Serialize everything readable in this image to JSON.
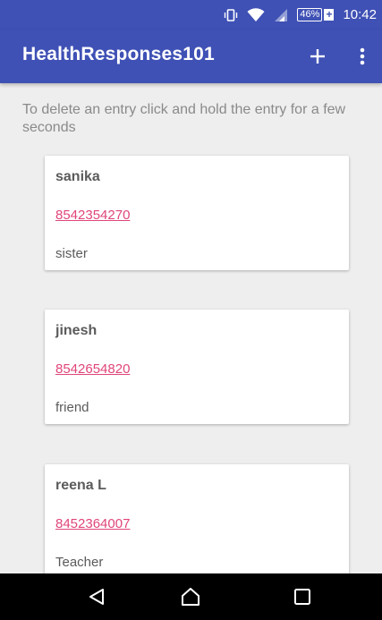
{
  "status_bar": {
    "icons": [
      "vibrate-icon",
      "wifi-icon",
      "signal-icon",
      "battery-icon"
    ],
    "battery": "46%",
    "time": "10:42"
  },
  "app_bar": {
    "title": "HealthResponses101",
    "actions": [
      "add-icon",
      "overflow-menu-icon"
    ]
  },
  "hint": "To delete an entry click and hold the entry for a few seconds",
  "entries": [
    {
      "name": "sanika",
      "phone": "8542354270",
      "relation": "sister"
    },
    {
      "name": "jinesh",
      "phone": "8542654820",
      "relation": "friend"
    },
    {
      "name": "reena L",
      "phone": "8452364007",
      "relation": "Teacher"
    }
  ],
  "nav_bar": {
    "buttons": [
      "back-icon",
      "home-icon",
      "recents-icon"
    ]
  },
  "colors": {
    "primary": "#3f51b5",
    "link": "#e0457a",
    "background": "#eeeeee"
  }
}
